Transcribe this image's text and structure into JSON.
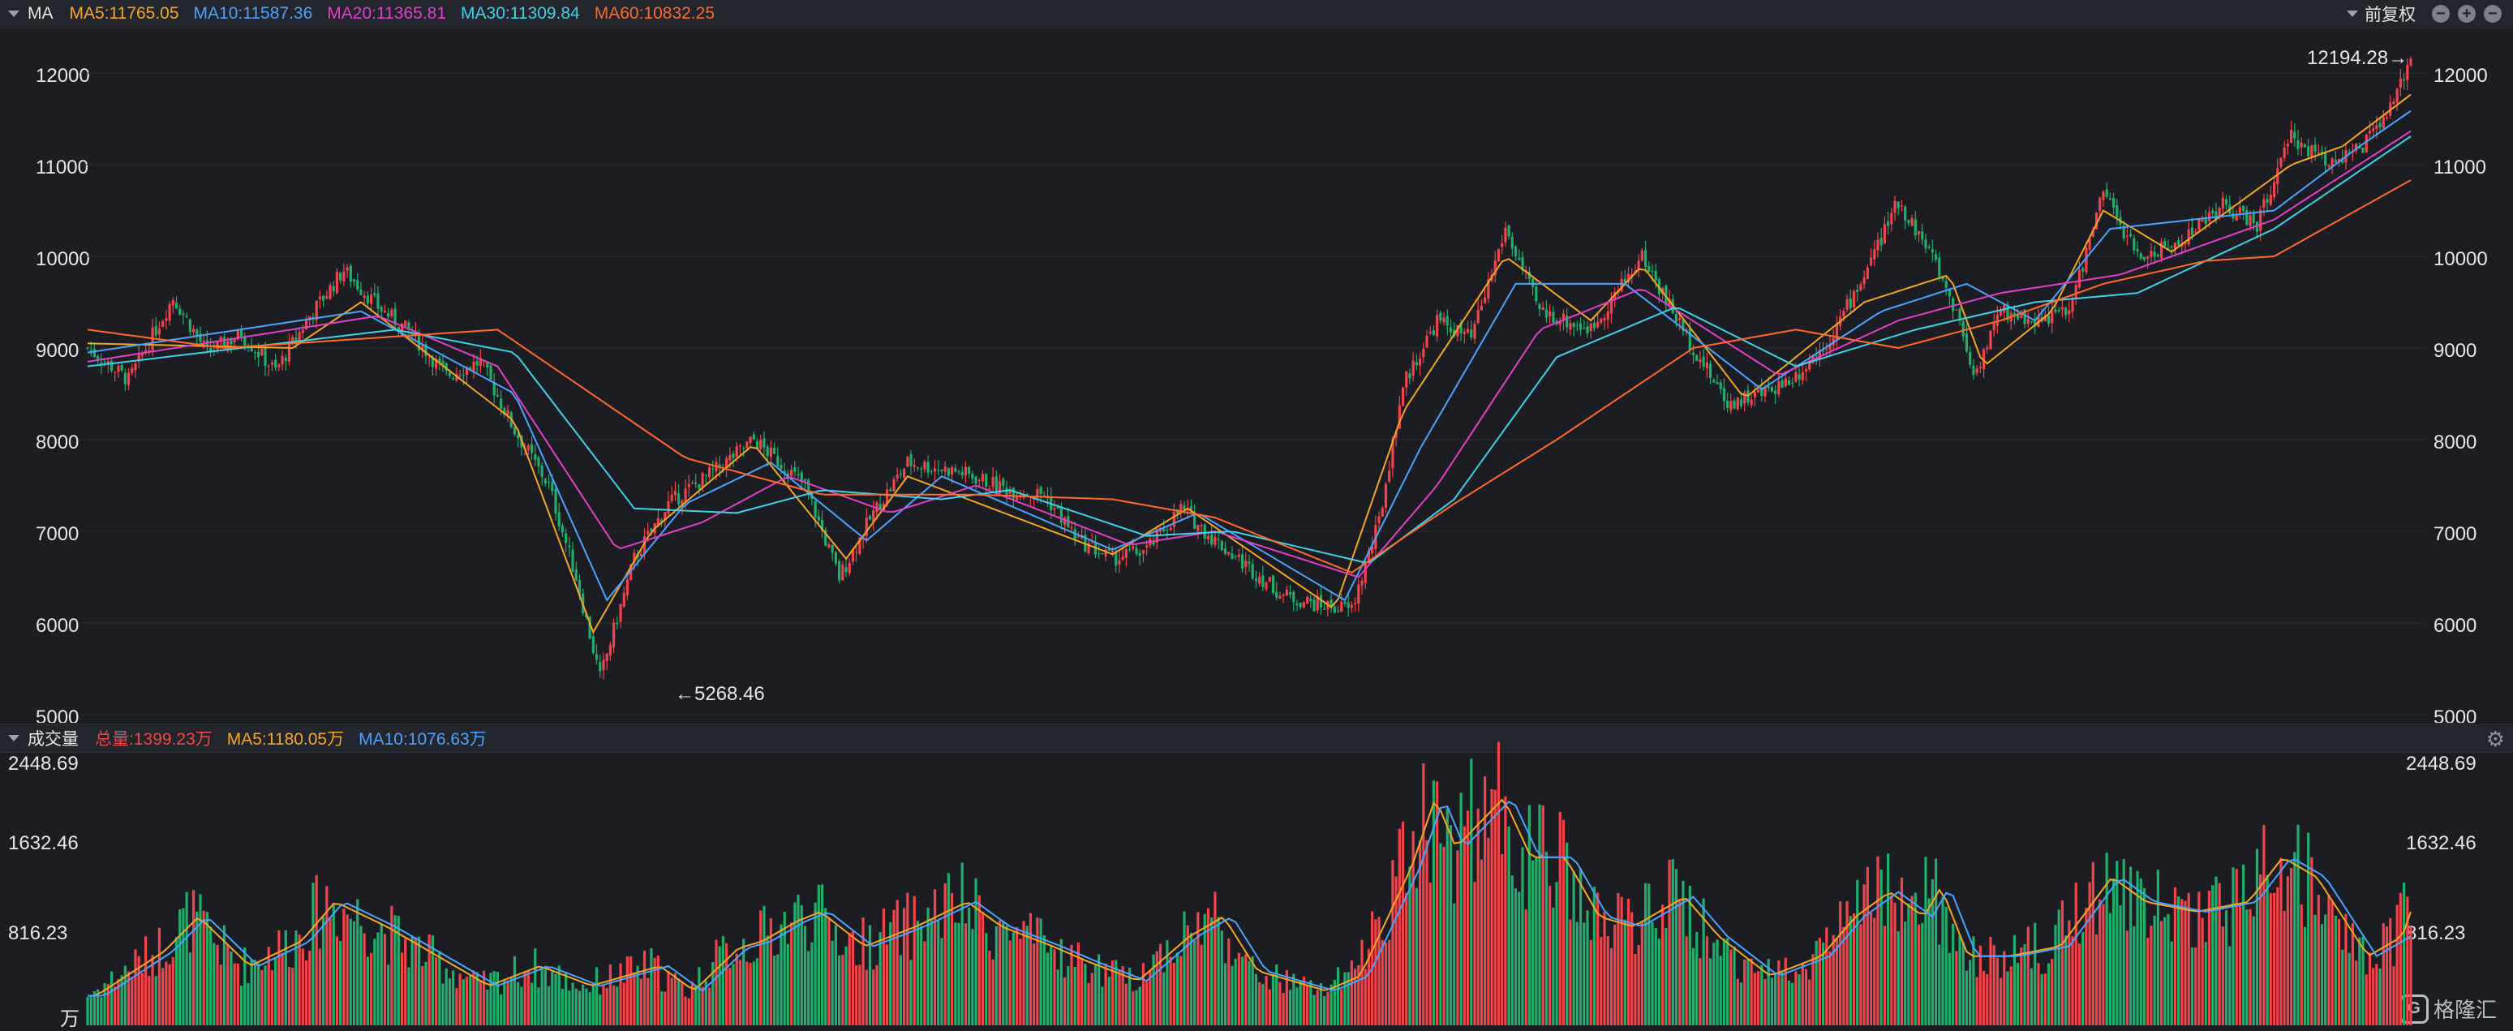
{
  "header": {
    "indicator": "MA",
    "ma_labels": [
      {
        "text": "MA5:11765.05",
        "color": "#f5a623"
      },
      {
        "text": "MA10:11587.36",
        "color": "#4aa3ff"
      },
      {
        "text": "MA20:11365.81",
        "color": "#e040c8"
      },
      {
        "text": "MA30:11309.84",
        "color": "#3fd1e6"
      },
      {
        "text": "MA60:10832.25",
        "color": "#ff6a2b"
      }
    ],
    "adjust_label": "前复权"
  },
  "volume_header": {
    "title": "成交量",
    "labels": [
      {
        "text": "总量:1399.23万",
        "color": "#f0444a"
      },
      {
        "text": "MA5:1180.05万",
        "color": "#f5a623"
      },
      {
        "text": "MA10:1076.63万",
        "color": "#4aa3ff"
      }
    ]
  },
  "price_axis": {
    "ticks": [
      "12000",
      "11000",
      "10000",
      "9000",
      "8000",
      "7000",
      "6000",
      "5000"
    ],
    "values": [
      12000,
      11000,
      10000,
      9000,
      8000,
      7000,
      6000,
      5000
    ]
  },
  "volume_axis": {
    "ticks": [
      "2448.69",
      "1632.46",
      "816.23"
    ],
    "values": [
      2448.69,
      1632.46,
      816.23
    ],
    "unit": "万"
  },
  "annotations": {
    "high": "12194.28→",
    "low": "←5268.46"
  },
  "brand": "格隆汇",
  "colors": {
    "up": "#f0444a",
    "down": "#1fae6b",
    "grid": "#2a2d33"
  },
  "chart_data": {
    "type": "candlestick",
    "price_anchors": [
      [
        0,
        9000
      ],
      [
        12,
        8650
      ],
      [
        25,
        9550
      ],
      [
        35,
        8950
      ],
      [
        45,
        9150
      ],
      [
        55,
        8750
      ],
      [
        65,
        9350
      ],
      [
        75,
        9850
      ],
      [
        85,
        9450
      ],
      [
        95,
        9150
      ],
      [
        105,
        8700
      ],
      [
        115,
        8850
      ],
      [
        125,
        8100
      ],
      [
        135,
        7500
      ],
      [
        143,
        6500
      ],
      [
        150,
        5400
      ],
      [
        160,
        6700
      ],
      [
        170,
        7300
      ],
      [
        185,
        7700
      ],
      [
        195,
        8000
      ],
      [
        210,
        7500
      ],
      [
        220,
        6500
      ],
      [
        230,
        7200
      ],
      [
        240,
        7750
      ],
      [
        255,
        7650
      ],
      [
        270,
        7450
      ],
      [
        280,
        7400
      ],
      [
        290,
        6900
      ],
      [
        300,
        6700
      ],
      [
        310,
        6800
      ],
      [
        320,
        7250
      ],
      [
        330,
        6900
      ],
      [
        340,
        6600
      ],
      [
        350,
        6300
      ],
      [
        360,
        6200
      ],
      [
        370,
        6150
      ],
      [
        378,
        7100
      ],
      [
        385,
        8600
      ],
      [
        395,
        9300
      ],
      [
        405,
        9100
      ],
      [
        415,
        10300
      ],
      [
        425,
        9400
      ],
      [
        440,
        9200
      ],
      [
        455,
        10000
      ],
      [
        470,
        9000
      ],
      [
        480,
        8400
      ],
      [
        490,
        8500
      ],
      [
        500,
        8700
      ],
      [
        510,
        9100
      ],
      [
        520,
        9800
      ],
      [
        530,
        10600
      ],
      [
        540,
        10000
      ],
      [
        548,
        9300
      ],
      [
        552,
        8700
      ],
      [
        560,
        9400
      ],
      [
        570,
        9300
      ],
      [
        580,
        9400
      ],
      [
        590,
        10700
      ],
      [
        600,
        10000
      ],
      [
        610,
        10100
      ],
      [
        625,
        10550
      ],
      [
        635,
        10350
      ],
      [
        645,
        11300
      ],
      [
        655,
        11050
      ],
      [
        665,
        11150
      ],
      [
        675,
        11650
      ],
      [
        680,
        12194
      ]
    ],
    "ma_series": {
      "MA5": [
        [
          0,
          9050
        ],
        [
          60,
          9000
        ],
        [
          80,
          9500
        ],
        [
          125,
          8200
        ],
        [
          148,
          5900
        ],
        [
          165,
          7000
        ],
        [
          195,
          7950
        ],
        [
          222,
          6700
        ],
        [
          240,
          7600
        ],
        [
          300,
          6750
        ],
        [
          322,
          7250
        ],
        [
          365,
          6150
        ],
        [
          385,
          8300
        ],
        [
          415,
          10000
        ],
        [
          440,
          9300
        ],
        [
          455,
          9900
        ],
        [
          485,
          8450
        ],
        [
          520,
          9500
        ],
        [
          545,
          9800
        ],
        [
          555,
          8800
        ],
        [
          575,
          9400
        ],
        [
          590,
          10500
        ],
        [
          610,
          10050
        ],
        [
          645,
          11000
        ],
        [
          660,
          11200
        ],
        [
          680,
          11765
        ]
      ],
      "MA10": [
        [
          0,
          8950
        ],
        [
          80,
          9400
        ],
        [
          125,
          8500
        ],
        [
          152,
          6250
        ],
        [
          175,
          7300
        ],
        [
          200,
          7750
        ],
        [
          228,
          6900
        ],
        [
          250,
          7600
        ],
        [
          300,
          6800
        ],
        [
          325,
          7200
        ],
        [
          368,
          6250
        ],
        [
          390,
          7900
        ],
        [
          418,
          9700
        ],
        [
          450,
          9700
        ],
        [
          490,
          8550
        ],
        [
          525,
          9400
        ],
        [
          550,
          9700
        ],
        [
          570,
          9300
        ],
        [
          592,
          10300
        ],
        [
          640,
          10500
        ],
        [
          665,
          11200
        ],
        [
          680,
          11587
        ]
      ],
      "MA20": [
        [
          0,
          8850
        ],
        [
          85,
          9350
        ],
        [
          120,
          8800
        ],
        [
          155,
          6800
        ],
        [
          180,
          7100
        ],
        [
          205,
          7600
        ],
        [
          235,
          7200
        ],
        [
          260,
          7500
        ],
        [
          305,
          6850
        ],
        [
          330,
          7000
        ],
        [
          372,
          6500
        ],
        [
          395,
          7500
        ],
        [
          425,
          9200
        ],
        [
          455,
          9650
        ],
        [
          495,
          8700
        ],
        [
          530,
          9300
        ],
        [
          560,
          9600
        ],
        [
          595,
          9800
        ],
        [
          640,
          10400
        ],
        [
          680,
          11366
        ]
      ],
      "MA30": [
        [
          0,
          8800
        ],
        [
          90,
          9200
        ],
        [
          125,
          8950
        ],
        [
          160,
          7250
        ],
        [
          190,
          7200
        ],
        [
          215,
          7450
        ],
        [
          250,
          7350
        ],
        [
          270,
          7450
        ],
        [
          310,
          6950
        ],
        [
          335,
          7000
        ],
        [
          375,
          6650
        ],
        [
          400,
          7350
        ],
        [
          430,
          8900
        ],
        [
          465,
          9450
        ],
        [
          500,
          8800
        ],
        [
          535,
          9200
        ],
        [
          570,
          9500
        ],
        [
          600,
          9600
        ],
        [
          640,
          10300
        ],
        [
          680,
          11310
        ]
      ],
      "MA60": [
        [
          0,
          9200
        ],
        [
          40,
          9000
        ],
        [
          120,
          9200
        ],
        [
          175,
          7800
        ],
        [
          215,
          7400
        ],
        [
          260,
          7400
        ],
        [
          300,
          7350
        ],
        [
          330,
          7150
        ],
        [
          370,
          6550
        ],
        [
          400,
          7300
        ],
        [
          430,
          8000
        ],
        [
          470,
          9000
        ],
        [
          500,
          9200
        ],
        [
          530,
          9000
        ],
        [
          560,
          9300
        ],
        [
          590,
          9700
        ],
        [
          620,
          9950
        ],
        [
          640,
          10000
        ],
        [
          680,
          10832
        ]
      ]
    },
    "volume_anchors": [
      [
        0,
        300
      ],
      [
        20,
        750
      ],
      [
        30,
        1100
      ],
      [
        45,
        600
      ],
      [
        60,
        850
      ],
      [
        70,
        1250
      ],
      [
        85,
        1000
      ],
      [
        100,
        700
      ],
      [
        115,
        400
      ],
      [
        130,
        600
      ],
      [
        145,
        400
      ],
      [
        165,
        600
      ],
      [
        175,
        350
      ],
      [
        188,
        780
      ],
      [
        195,
        850
      ],
      [
        205,
        1050
      ],
      [
        212,
        1150
      ],
      [
        225,
        800
      ],
      [
        240,
        1000
      ],
      [
        255,
        1250
      ],
      [
        265,
        1000
      ],
      [
        280,
        800
      ],
      [
        290,
        650
      ],
      [
        305,
        450
      ],
      [
        320,
        900
      ],
      [
        330,
        1100
      ],
      [
        340,
        550
      ],
      [
        360,
        350
      ],
      [
        370,
        500
      ],
      [
        385,
        1600
      ],
      [
        392,
        2300
      ],
      [
        398,
        1800
      ],
      [
        412,
        2300
      ],
      [
        420,
        1700
      ],
      [
        430,
        1700
      ],
      [
        440,
        1100
      ],
      [
        450,
        1000
      ],
      [
        465,
        1300
      ],
      [
        475,
        900
      ],
      [
        490,
        500
      ],
      [
        505,
        700
      ],
      [
        515,
        1100
      ],
      [
        525,
        1350
      ],
      [
        535,
        1100
      ],
      [
        540,
        1400
      ],
      [
        548,
        700
      ],
      [
        560,
        700
      ],
      [
        575,
        800
      ],
      [
        590,
        1500
      ],
      [
        600,
        1250
      ],
      [
        615,
        1150
      ],
      [
        630,
        1250
      ],
      [
        640,
        1700
      ],
      [
        650,
        1500
      ],
      [
        665,
        700
      ],
      [
        675,
        900
      ],
      [
        680,
        1399
      ]
    ],
    "ma5_volume": [
      1180.05
    ],
    "ma10_volume": [
      1076.63
    ],
    "total_volume": 1399.23,
    "annotated_high": 12194.28,
    "annotated_low": 5268.46,
    "y_range_price": [
      5000,
      12350
    ],
    "y_range_volume": [
      0,
      2500
    ],
    "candle_count": 681
  }
}
